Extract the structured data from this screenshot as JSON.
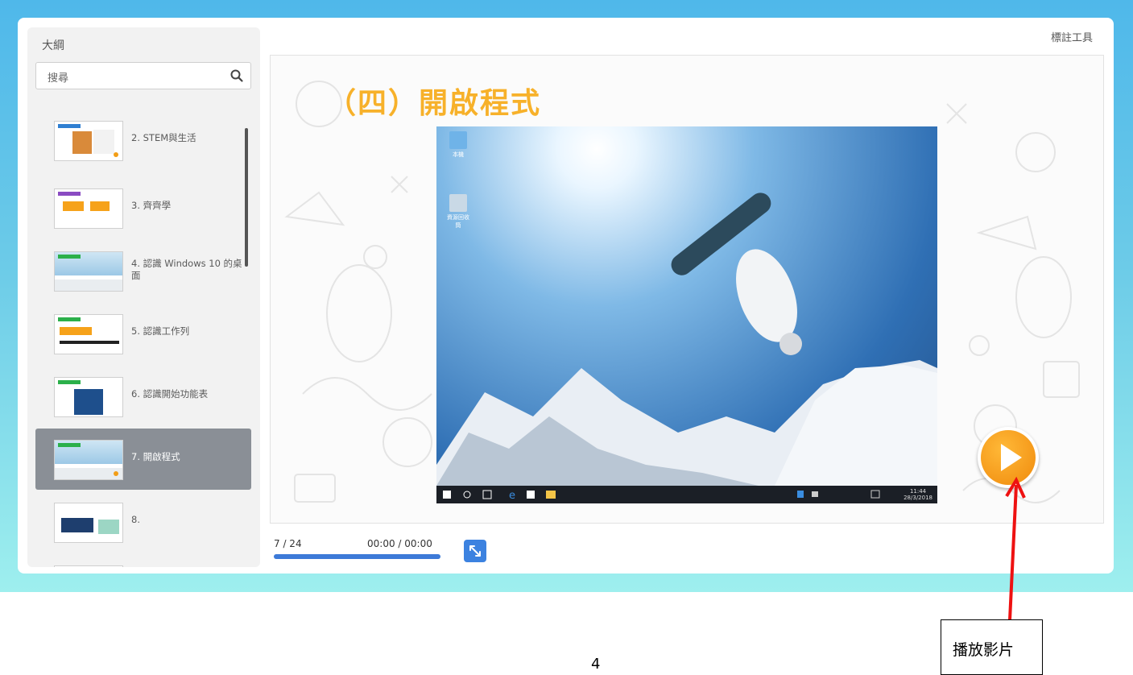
{
  "sidebar": {
    "title": "大綱",
    "search_placeholder": "搜尋",
    "items": [
      {
        "label": "2. STEM與生活"
      },
      {
        "label": "3. 齊齊學"
      },
      {
        "label": "4. 認識 Windows 10 的桌面"
      },
      {
        "label": "5. 認識工作列"
      },
      {
        "label": "6. 認識開始功能表"
      },
      {
        "label": "7. 開啟程式",
        "active": true
      },
      {
        "label": "8."
      },
      {
        "label": ""
      }
    ]
  },
  "toolbar": {
    "annotate_label": "標註工具"
  },
  "slide": {
    "title": "（四）開啟程式",
    "desktop_icons": [
      "本機",
      "資源回收筒"
    ],
    "clock_time": "11:44",
    "clock_date": "28/3/2018"
  },
  "player": {
    "page": "7 / 24",
    "time": "00:00 / 00:00",
    "progress": 1.0
  },
  "annotation": {
    "callout_text": "播放影片",
    "arrow_color": "#ee1111"
  },
  "footer": {
    "page_number": "4"
  },
  "colors": {
    "accent": "#f7b12a",
    "play": "#f29d16",
    "progress": "#3d7ad8",
    "active_item": "#8a8f96"
  }
}
